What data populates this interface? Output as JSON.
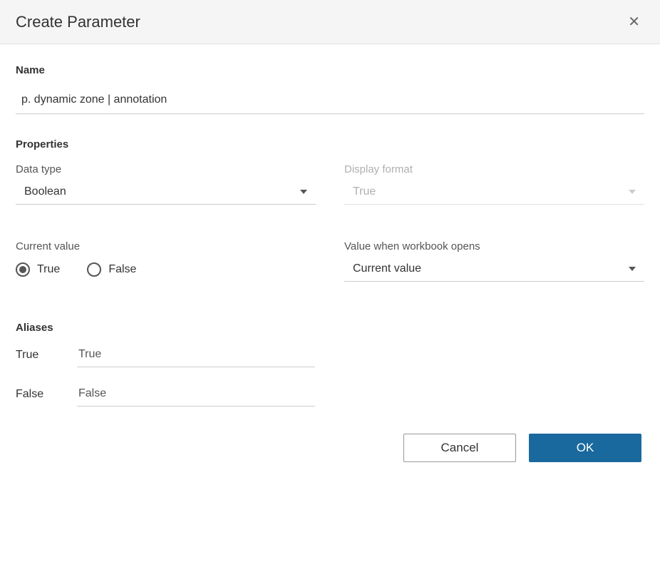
{
  "dialog": {
    "title": "Create Parameter"
  },
  "name": {
    "label": "Name",
    "value": "p. dynamic zone | annotation"
  },
  "properties": {
    "heading": "Properties",
    "data_type": {
      "label": "Data type",
      "value": "Boolean"
    },
    "display_format": {
      "label": "Display format",
      "value": "True"
    },
    "current_value": {
      "label": "Current value",
      "options": {
        "true_label": "True",
        "false_label": "False"
      },
      "selected": "True"
    },
    "value_when_open": {
      "label": "Value when workbook opens",
      "value": "Current value"
    }
  },
  "aliases": {
    "heading": "Aliases",
    "true_key": "True",
    "true_value": "True",
    "false_key": "False",
    "false_value": "False"
  },
  "buttons": {
    "cancel": "Cancel",
    "ok": "OK"
  }
}
